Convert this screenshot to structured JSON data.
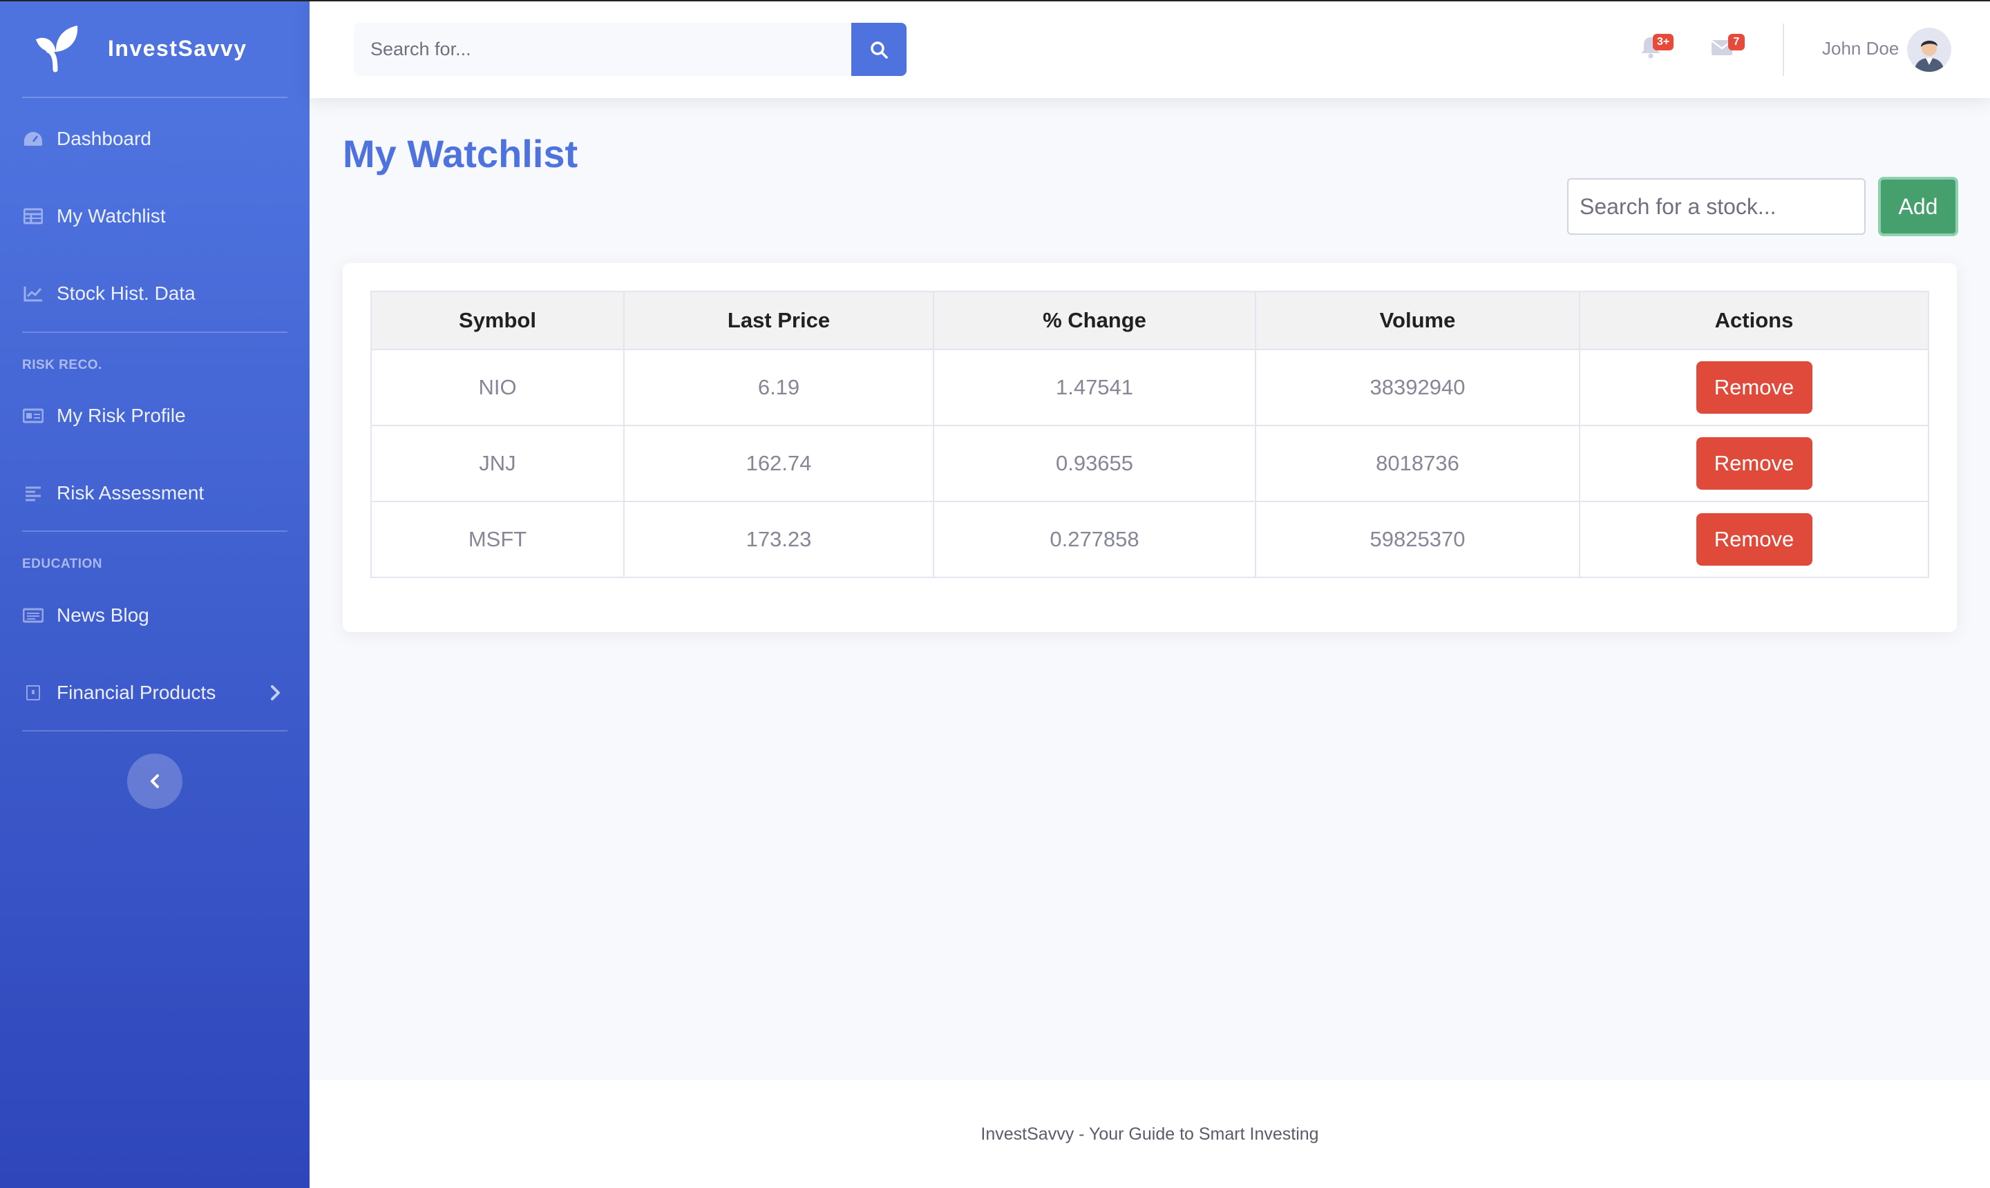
{
  "brand": {
    "name": "InvestSavvy"
  },
  "sidebar": {
    "items": [
      {
        "label": "Dashboard",
        "icon": "dashboard-icon"
      },
      {
        "label": "My Watchlist",
        "icon": "table-icon"
      },
      {
        "label": "Stock Hist. Data",
        "icon": "chart-line-icon"
      }
    ],
    "sections": [
      {
        "heading": "RISK RECO.",
        "items": [
          {
            "label": "My Risk Profile",
            "icon": "id-card-icon"
          },
          {
            "label": "Risk Assessment",
            "icon": "list-icon"
          }
        ]
      },
      {
        "heading": "EDUCATION",
        "items": [
          {
            "label": "News Blog",
            "icon": "newspaper-icon"
          },
          {
            "label": "Financial Products",
            "icon": "product-icon"
          }
        ]
      }
    ]
  },
  "topbar": {
    "search": {
      "placeholder": "Search for..."
    },
    "alerts_count": "3+",
    "messages_count": "7",
    "user": {
      "name": "John Doe"
    }
  },
  "main": {
    "title": "My Watchlist",
    "stock_search": {
      "placeholder": "Search for a stock..."
    },
    "add_label": "Add",
    "table": {
      "headers": [
        "Symbol",
        "Last Price",
        "% Change",
        "Volume",
        "Actions"
      ],
      "rows": [
        {
          "symbol": "NIO",
          "price": "6.19",
          "change": "1.47541",
          "volume": "38392940",
          "action": "Remove"
        },
        {
          "symbol": "JNJ",
          "price": "162.74",
          "change": "0.93655",
          "volume": "8018736",
          "action": "Remove"
        },
        {
          "symbol": "MSFT",
          "price": "173.23",
          "change": "0.277858",
          "volume": "59825370",
          "action": "Remove"
        }
      ]
    }
  },
  "footer": {
    "text": "InvestSavvy - Your Guide to Smart Investing"
  },
  "colors": {
    "primary": "#4e73df",
    "success": "#45a06d",
    "danger": "#e04a3a"
  }
}
